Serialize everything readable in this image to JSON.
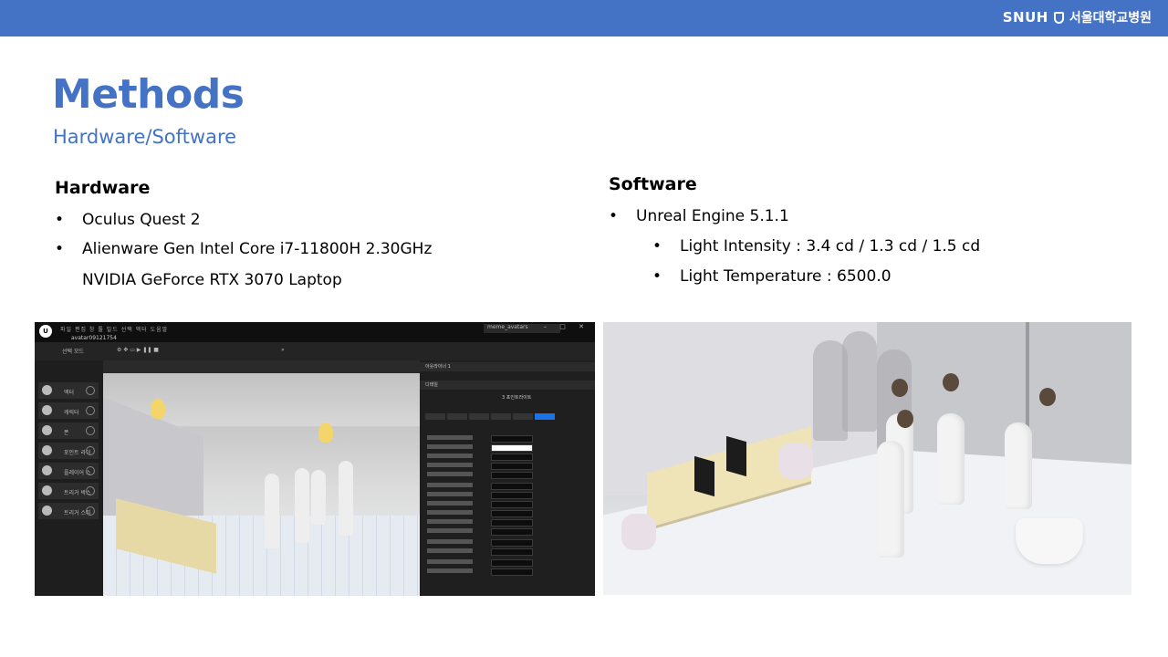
{
  "header": {
    "logo_text": "SNUH",
    "logo_korean": "서울대학교병원"
  },
  "slide": {
    "title": "Methods",
    "subtitle": "Hardware/Software"
  },
  "hardware": {
    "heading": "Hardware",
    "items": [
      {
        "text": "Oculus Quest 2"
      },
      {
        "text": "Alienware Gen Intel Core i7-11800H 2.30GHz",
        "continuation": "NVIDIA GeForce RTX 3070 Laptop"
      }
    ]
  },
  "software": {
    "heading": "Software",
    "items": [
      {
        "level": 1,
        "text": "Unreal Engine 5.1.1"
      },
      {
        "level": 2,
        "text": "Light Intensity : 3.4 cd / 1.3 cd / 1.5 cd"
      },
      {
        "level": 2,
        "text": "Light Temperature : 6500.0"
      }
    ]
  },
  "editor_screenshot": {
    "menu": "파일 편집 창 툴 빌드 선택 액터 도움말",
    "tab": "avatar09121754",
    "project": "meme_avatars",
    "mode": "선택 모드",
    "left_panel_items": [
      "액터",
      "캐릭터",
      "폰",
      "포인트 라이",
      "플레이어 스",
      "트리거 박스",
      "트리거 스피"
    ],
    "outliner_title": "아웃라이너 1",
    "details_title": "디테일",
    "details_selection": "3 포인트라이트",
    "details_tabs": [
      "일반",
      "액터",
      "기타",
      "렌더링",
      "스트리밍",
      "전체"
    ],
    "rows": [
      {
        "key": "강도",
        "value": "다수의 값"
      },
      {
        "key": "라이트 컬러",
        "value": ""
      },
      {
        "key": "R",
        "value": "255"
      },
      {
        "key": "G",
        "value": "255"
      },
      {
        "key": "B",
        "value": "255"
      },
      {
        "key": "어테뉴에이션 반경",
        "value": "다수의 값"
      },
      {
        "key": "소스 반경",
        "value": "다수의 값"
      },
      {
        "key": "소프트 소스 반경",
        "value": "0.0"
      },
      {
        "key": "소스 길이",
        "value": "0.0"
      },
      {
        "key": "온도 사용",
        "value": ""
      },
      {
        "key": "온도",
        "value": "6500.0"
      },
      {
        "key": "캐스트 섀도",
        "value": ""
      },
      {
        "key": "간접광 강도",
        "value": "다수의 값"
      },
      {
        "key": "볼류메트릭 스캐터링 강도",
        "value": "1.0"
      }
    ]
  },
  "render_screenshot": {
    "description_hidden": ""
  }
}
